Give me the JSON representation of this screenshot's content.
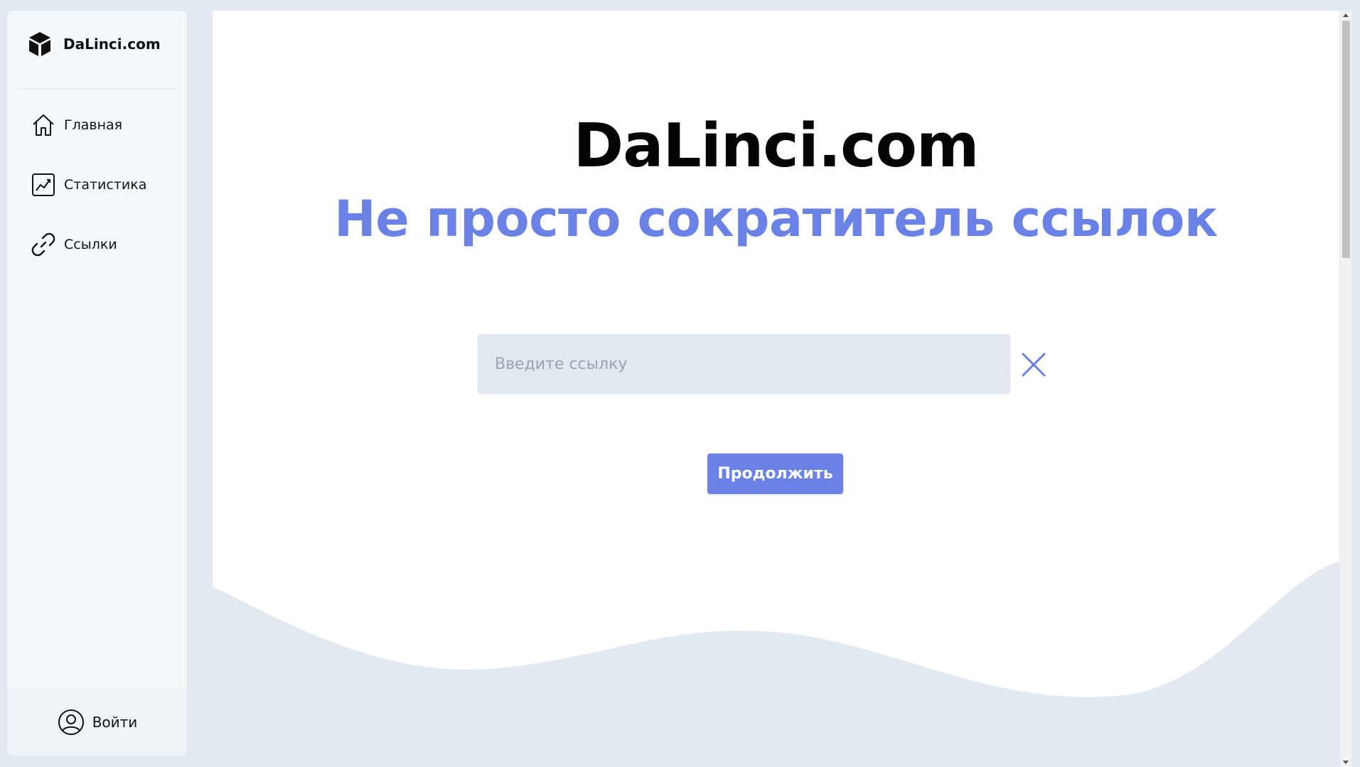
{
  "sidebar": {
    "brand": {
      "name": "DaLinci.com",
      "icon": "cube-icon"
    },
    "items": [
      {
        "label": "Главная",
        "icon": "home-icon"
      },
      {
        "label": "Статистика",
        "icon": "chart-icon"
      },
      {
        "label": "Ссылки",
        "icon": "link-icon"
      }
    ],
    "footer": {
      "login_label": "Войти",
      "icon": "user-circle-icon"
    }
  },
  "main": {
    "title": "DaLinci.com",
    "subtitle": "Не просто сократитель ссылок",
    "input": {
      "placeholder": "Введите ссылку",
      "value": ""
    },
    "clear_icon": "close-icon",
    "continue_label": "Продолжить"
  },
  "colors": {
    "accent": "#6a82e6",
    "background": "#e3e9f1",
    "sidebar": "#f6f9fc",
    "input": "#e2e8f0"
  }
}
